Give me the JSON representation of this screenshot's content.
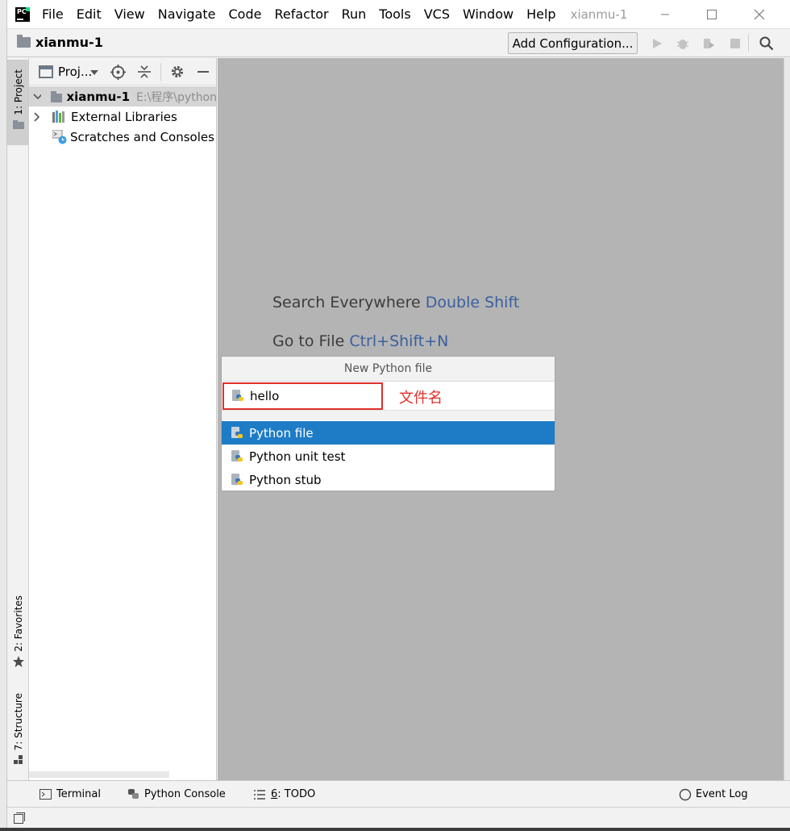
{
  "window": {
    "logo_text": "PC",
    "menu": [
      "File",
      "Edit",
      "View",
      "Navigate",
      "Code",
      "Refactor",
      "Run",
      "Tools",
      "VCS",
      "Window",
      "Help"
    ],
    "title_project": "xianmu-1"
  },
  "nav_bar": {
    "project_name": "xianmu-1",
    "add_configuration": "Add Configuration..."
  },
  "left_stripe": {
    "project_tab": "1: Project",
    "favorites_tab": "2: Favorites",
    "structure_tab": "7: Structure"
  },
  "project_panel": {
    "header_label": "Proj...",
    "tree": {
      "root_name": "xianmu-1",
      "root_path": "E:\\程序\\python",
      "external_libraries": "External Libraries",
      "scratches": "Scratches and Consoles"
    }
  },
  "editor": {
    "hint_search": "Search Everywhere",
    "hint_search_key": "Double Shift",
    "hint_goto": "Go to File",
    "hint_goto_key": "Ctrl+Shift+N"
  },
  "popup": {
    "title": "New Python file",
    "name_value": "hello",
    "annotation": "文件名",
    "options": [
      "Python file",
      "Python unit test",
      "Python stub"
    ],
    "selected_index": 0
  },
  "bottom_bar": {
    "terminal": "Terminal",
    "python_console": "Python Console",
    "todo_num": "6",
    "todo": ": TODO",
    "event_log": "Event Log"
  },
  "colors": {
    "selection": "#1e7cc6",
    "annotation": "#e0302c",
    "key_hint": "#3a5f9f",
    "editor_bg": "#b4b4b4"
  }
}
